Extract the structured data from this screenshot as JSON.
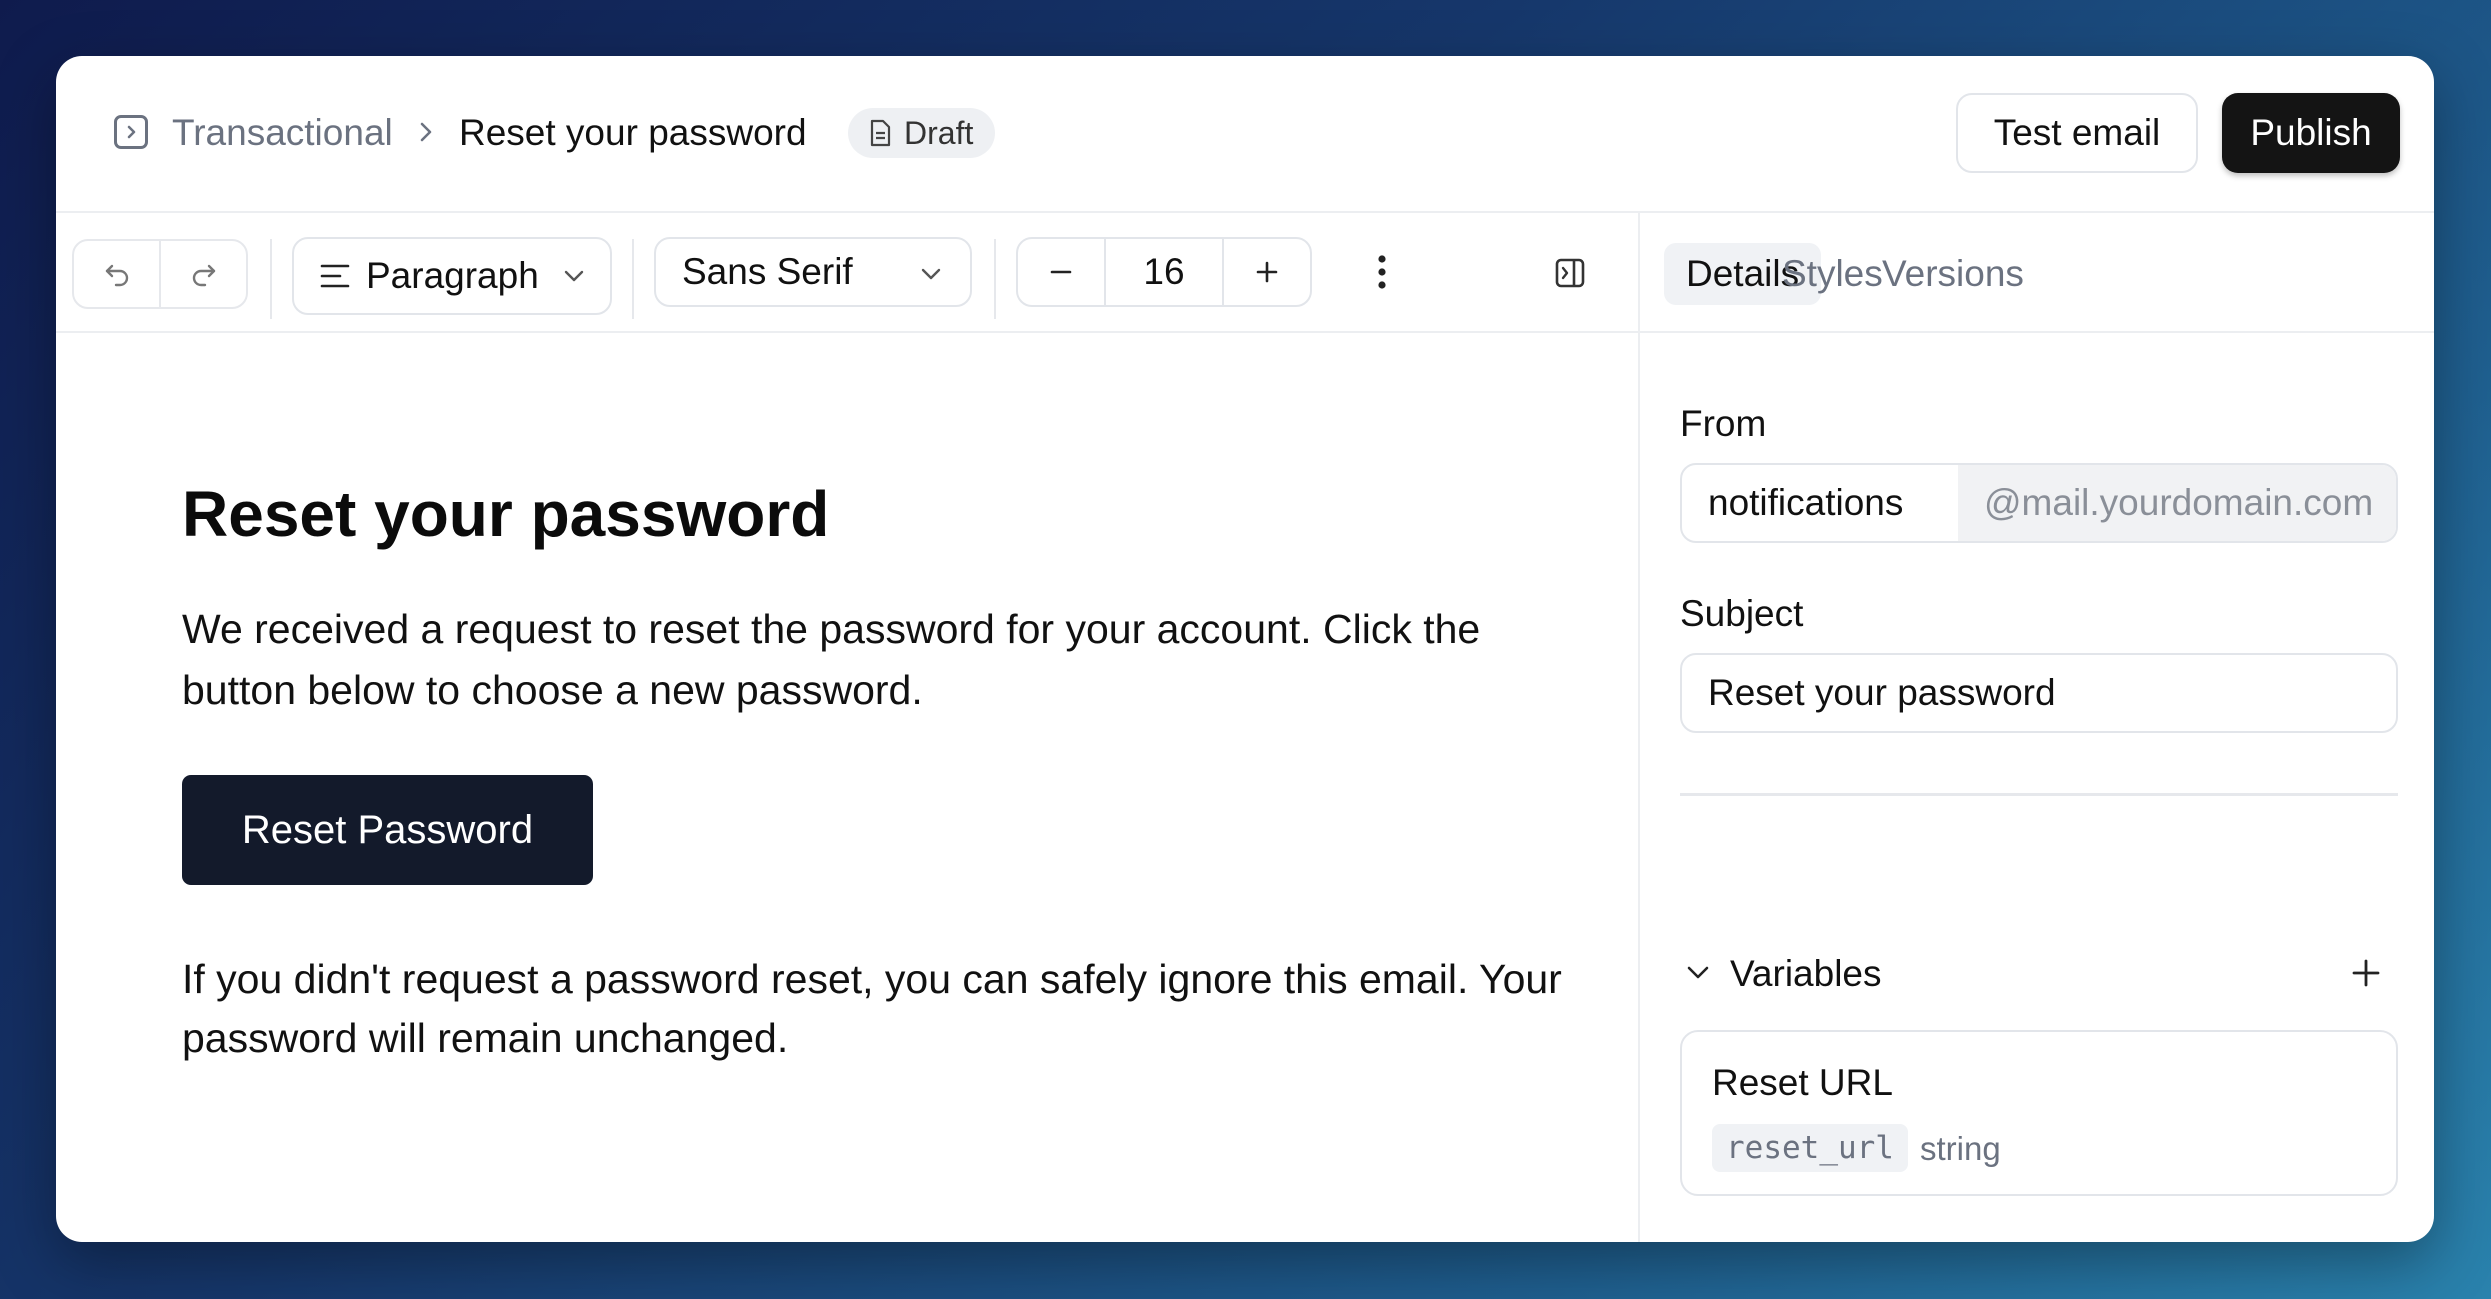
{
  "header": {
    "breadcrumb": [
      "Transactional",
      "Reset your password"
    ],
    "status_badge": "Draft",
    "test_email_label": "Test email",
    "publish_label": "Publish"
  },
  "toolbar": {
    "block_type": "Paragraph",
    "font_family": "Sans Serif",
    "font_size": "16"
  },
  "editor": {
    "title": "Reset your password",
    "body1": "We received a request to reset the password for your account. Click the button below to choose a new password.",
    "button_label": "Reset Password",
    "body2": "If you didn't request a password reset, you can safely ignore this email. Your password will remain unchanged."
  },
  "panel": {
    "tabs": [
      "Details",
      "Styles",
      "Versions"
    ],
    "active_tab": "Details",
    "from_label": "From",
    "from_local": "notifications",
    "from_domain": "@mail.yourdomain.com",
    "subject_label": "Subject",
    "subject_value": "Reset your password",
    "variables_label": "Variables",
    "variables": [
      {
        "name": "Reset URL",
        "key": "reset_url",
        "type": "string"
      }
    ]
  },
  "colors": {
    "primary_button": "#131a2b",
    "publish_button": "#141414",
    "muted_text": "#6b7280"
  }
}
